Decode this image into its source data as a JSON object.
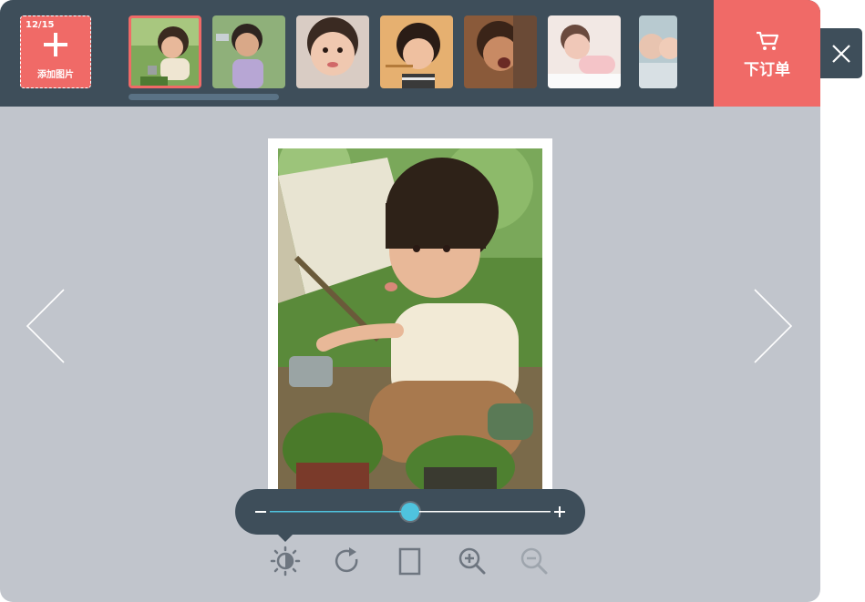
{
  "toolbar": {
    "photo_count": "12/15",
    "add_label": "添加图片",
    "order_label": "下订单"
  },
  "thumbnails": [
    {
      "name": "thumb-1",
      "selected": true
    },
    {
      "name": "thumb-2",
      "selected": false
    },
    {
      "name": "thumb-3",
      "selected": false
    },
    {
      "name": "thumb-4",
      "selected": false
    },
    {
      "name": "thumb-5",
      "selected": false
    },
    {
      "name": "thumb-6",
      "selected": false
    },
    {
      "name": "thumb-7",
      "selected": false
    }
  ],
  "zoom": {
    "level": 0.5,
    "minus_icon": "minus-icon",
    "plus_icon": "plus-icon"
  },
  "tools": [
    "brightness-icon",
    "rotate-icon",
    "crop-icon",
    "zoom-in-icon",
    "zoom-out-icon"
  ],
  "colors": {
    "accent": "#f06a67",
    "dark": "#3e4e5a",
    "background": "#c1c5cc",
    "slider": "#4fc3de"
  }
}
